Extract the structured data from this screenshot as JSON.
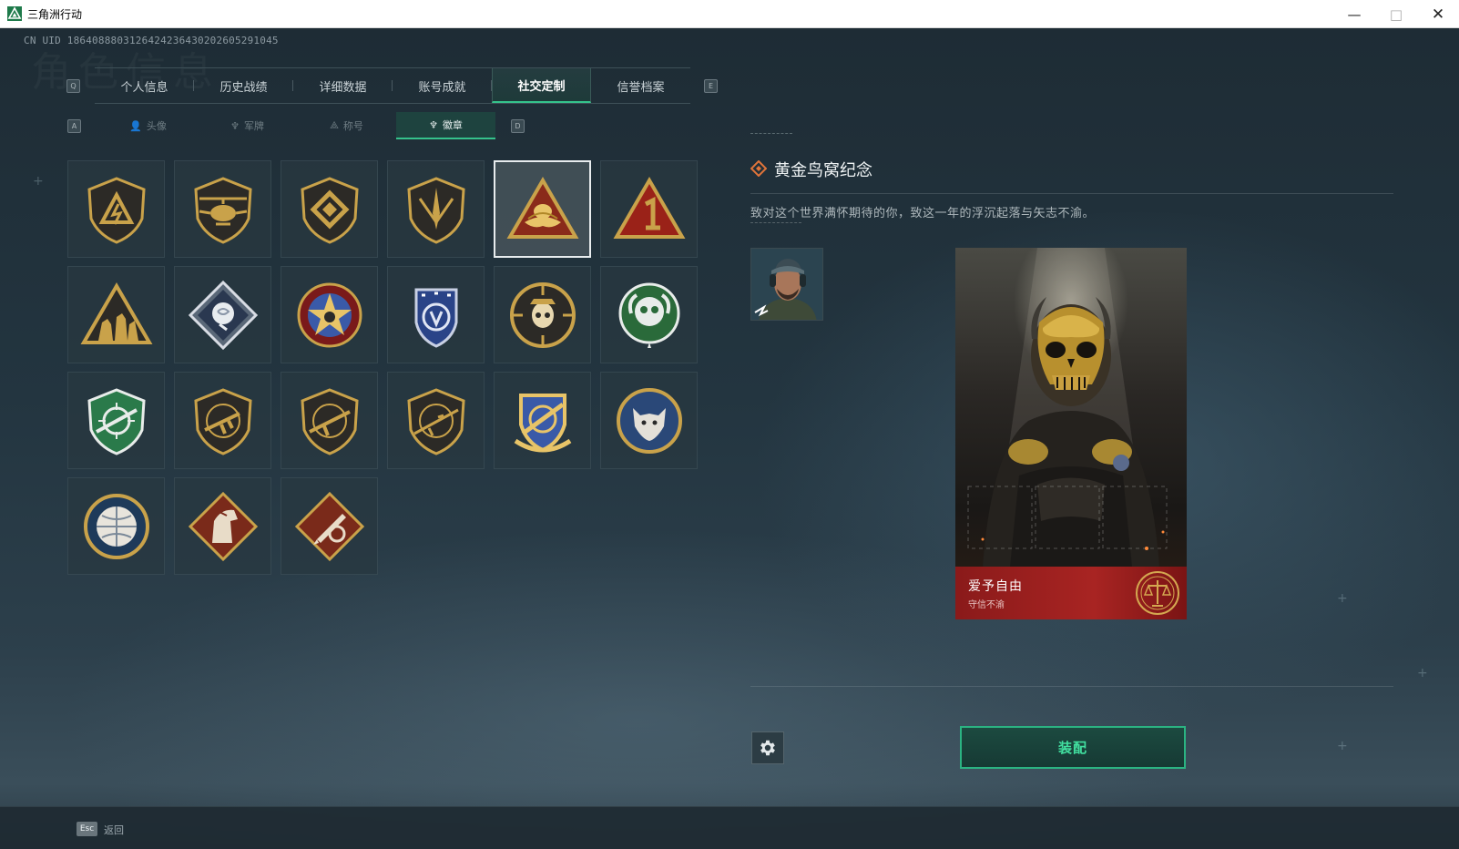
{
  "window": {
    "title": "三角洲行动"
  },
  "uid": "CN UID 1864088803126424236430202605291045",
  "watermark": "角色信息",
  "key_hints": {
    "prev_tab": "Q",
    "next_tab": "E",
    "prev_sub": "A",
    "next_sub": "D"
  },
  "main_tabs": [
    {
      "label": "个人信息",
      "active": false
    },
    {
      "label": "历史战绩",
      "active": false
    },
    {
      "label": "详细数据",
      "active": false
    },
    {
      "label": "账号成就",
      "active": false
    },
    {
      "label": "社交定制",
      "active": true
    },
    {
      "label": "信誉档案",
      "active": false
    }
  ],
  "sub_tabs": [
    {
      "label": "头像",
      "icon": "person-icon",
      "glyph": "👤",
      "active": false
    },
    {
      "label": "军牌",
      "icon": "dogtag-icon",
      "glyph": "♆",
      "active": false
    },
    {
      "label": "称号",
      "icon": "title-icon",
      "glyph": "⟁",
      "active": false
    },
    {
      "label": "徽章",
      "icon": "badge-icon",
      "glyph": "♆",
      "active": true
    }
  ],
  "badges": [
    {
      "name": "badge-lightning-shield",
      "selected": false
    },
    {
      "name": "badge-helicopter-shield",
      "selected": false
    },
    {
      "name": "badge-diamond-shield",
      "selected": false
    },
    {
      "name": "badge-dagger-shield",
      "selected": false
    },
    {
      "name": "badge-golden-nest-triangle",
      "selected": true
    },
    {
      "name": "badge-number-one-triangle",
      "selected": false
    },
    {
      "name": "badge-squad-triangle",
      "selected": false
    },
    {
      "name": "badge-rose-diamond",
      "selected": false
    },
    {
      "name": "badge-star-emblem",
      "selected": false
    },
    {
      "name": "badge-blue-shield",
      "selected": false
    },
    {
      "name": "badge-skull-circle",
      "selected": false
    },
    {
      "name": "badge-green-wreath",
      "selected": false
    },
    {
      "name": "badge-green-rifle-shield",
      "selected": false
    },
    {
      "name": "badge-smg-shield",
      "selected": false
    },
    {
      "name": "badge-rifle-shield",
      "selected": false
    },
    {
      "name": "badge-sniper-shield",
      "selected": false
    },
    {
      "name": "badge-gold-crosshair",
      "selected": false
    },
    {
      "name": "badge-wolf-circle",
      "selected": false
    },
    {
      "name": "badge-globe-circle",
      "selected": false
    },
    {
      "name": "badge-horse-diamond",
      "selected": false
    },
    {
      "name": "badge-pen-diamond",
      "selected": false
    }
  ],
  "detail": {
    "title": "黄金鸟窝纪念",
    "description": "致对这个世界满怀期待的你，致这一年的浮沉起落与矢志不渝。"
  },
  "card": {
    "banner_title": "爱予自由",
    "banner_subtitle": "守信不渝"
  },
  "actions": {
    "equip": "装配"
  },
  "footer": {
    "esc_key": "Esc",
    "esc_label": "返回"
  },
  "colors": {
    "accent": "#35c28b",
    "equip_text": "#42e0a0",
    "banner_red": "#a82422",
    "gold": "#c9a24a"
  }
}
